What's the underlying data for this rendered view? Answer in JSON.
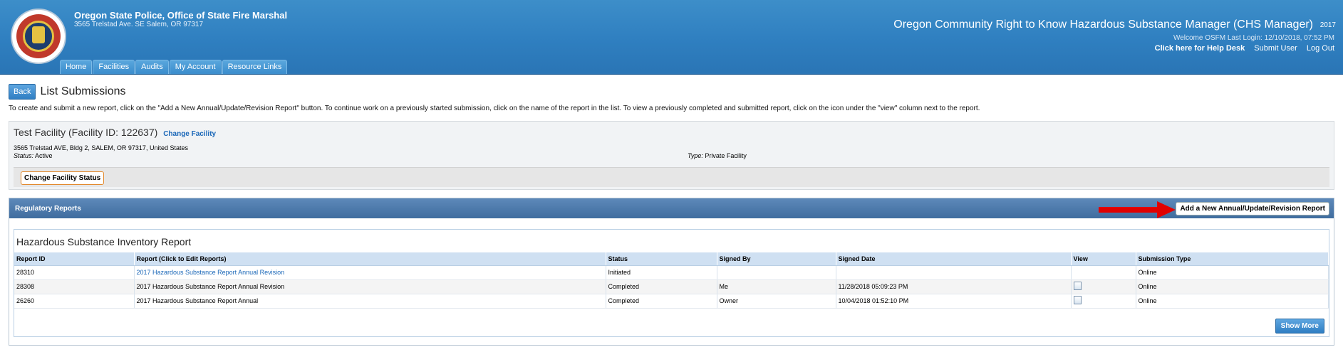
{
  "header": {
    "agency_title": "Oregon State Police, Office of State Fire Marshal",
    "agency_address": "3565 Trelstad Ave. SE Salem, OR 97317",
    "app_title": "Oregon Community Right to Know Hazardous Substance Manager (CHS Manager)",
    "app_year": "2017",
    "welcome": "Welcome OSFM   Last Login: 12/10/2018, 07:52 PM",
    "links": {
      "help_desk": "Click here for Help Desk",
      "submit_user": "Submit User",
      "log_out": "Log Out"
    },
    "logo_icon": "fire-marshal-seal-icon"
  },
  "nav": {
    "tabs": [
      "Home",
      "Facilities",
      "Audits",
      "My Account",
      "Resource Links"
    ]
  },
  "page": {
    "back_label": "Back",
    "title": "List Submissions",
    "instructions": "To create and submit a new report, click on the \"Add a New Annual/Update/Revision Report\" button. To continue work on a previously started submission, click on the name of the report in the list. To view a previously completed and submitted report, click on the icon under the \"view\" column next to the report."
  },
  "facility": {
    "name": "Test Facility (Facility ID: 122637)",
    "change_label": "Change Facility",
    "address": "3565 Trelstad AVE, Bldg 2, SALEM, OR 97317, United States",
    "status_label": "Status:",
    "status_value": "Active",
    "type_label": "Type:",
    "type_value": "Private Facility",
    "change_status_label": "Change Facility Status"
  },
  "reports": {
    "section_title": "Regulatory Reports",
    "add_button_label": "Add a New Annual/Update/Revision Report",
    "arrow_color": "#e00000",
    "inventory_title": "Hazardous Substance Inventory Report",
    "columns": [
      "Report ID",
      "Report (Click to Edit Reports)",
      "Status",
      "Signed By",
      "Signed Date",
      "View",
      "Submission Type"
    ],
    "rows": [
      {
        "id": "28310",
        "report": "2017 Hazardous Substance Report Annual Revision",
        "status": "Initiated",
        "signed_by": "",
        "signed_date": "",
        "view_icon": "",
        "submission_type": "Online"
      },
      {
        "id": "28308",
        "report": "2017 Hazardous Substance Report Annual Revision",
        "status": "Completed",
        "signed_by": "Me",
        "signed_date": "11/28/2018 05:09:23 PM",
        "view_icon": "document-icon",
        "submission_type": "Online"
      },
      {
        "id": "26260",
        "report": "2017 Hazardous Substance Report Annual",
        "status": "Completed",
        "signed_by": "Owner",
        "signed_date": "10/04/2018 01:52:10 PM",
        "view_icon": "document-icon",
        "submission_type": "Online"
      }
    ],
    "show_more_label": "Show More"
  }
}
